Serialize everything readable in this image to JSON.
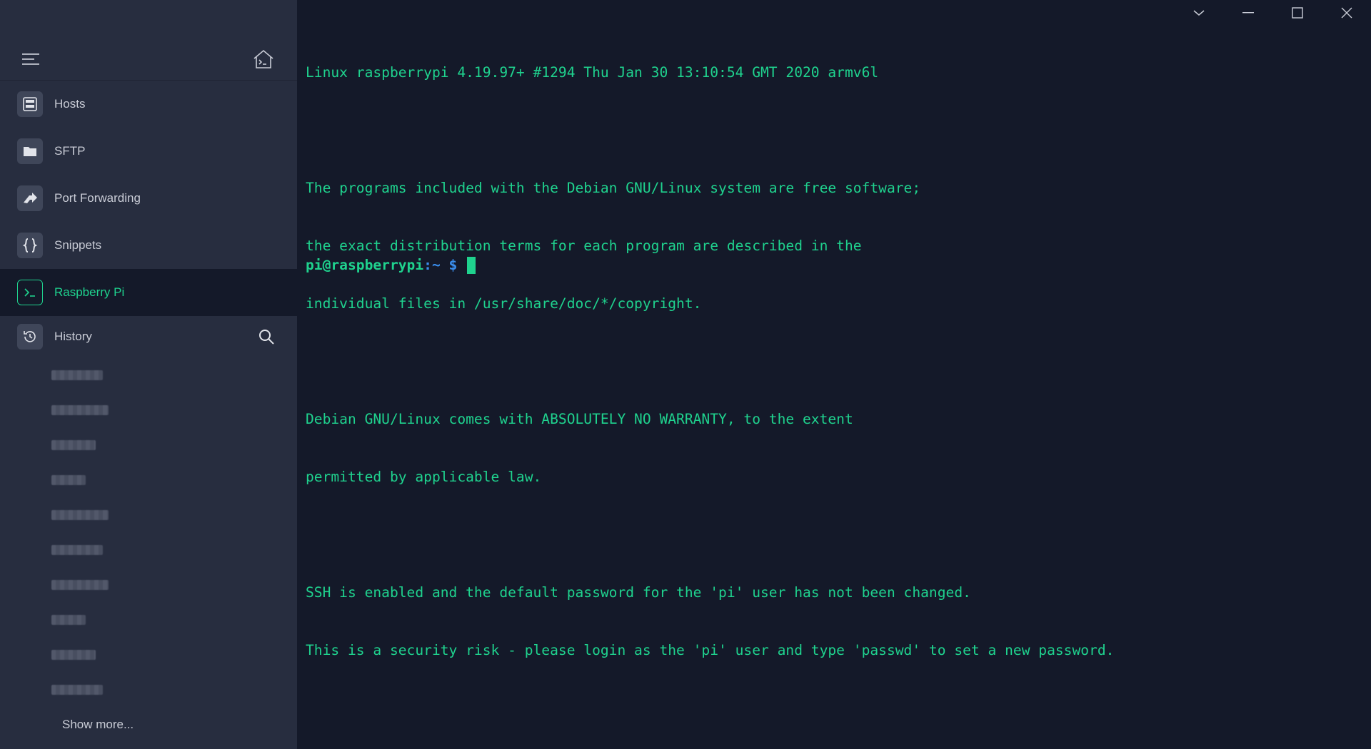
{
  "colors": {
    "accent": "#1fd28e",
    "sidebar_bg": "#272d3f",
    "terminal_bg": "#141929",
    "prompt_path": "#3a8ff0"
  },
  "sidebar": {
    "menu_icon": "hamburger-icon",
    "home_icon": "home-terminal-icon",
    "items": [
      {
        "label": "Hosts",
        "icon": "server-icon"
      },
      {
        "label": "SFTP",
        "icon": "folder-icon"
      },
      {
        "label": "Port Forwarding",
        "icon": "forward-arrow-icon"
      },
      {
        "label": "Snippets",
        "icon": "braces-icon"
      },
      {
        "label": "Raspberry Pi",
        "icon": "terminal-icon",
        "active": true
      }
    ],
    "history": {
      "label": "History",
      "icon": "history-icon",
      "search_icon": "search-icon",
      "items_count_visible": 10,
      "show_more_label": "Show more..."
    }
  },
  "terminal": {
    "lines": [
      "Linux raspberrypi 4.19.97+ #1294 Thu Jan 30 13:10:54 GMT 2020 armv6l",
      "",
      "The programs included with the Debian GNU/Linux system are free software;",
      "the exact distribution terms for each program are described in the",
      "individual files in /usr/share/doc/*/copyright.",
      "",
      "Debian GNU/Linux comes with ABSOLUTELY NO WARRANTY, to the extent",
      "permitted by applicable law.",
      "",
      "SSH is enabled and the default password for the 'pi' user has not been changed.",
      "This is a security risk - please login as the 'pi' user and type 'passwd' to set a new password."
    ],
    "prompt": {
      "user_host": "pi@raspberrypi",
      "path": ":~",
      "symbol": " $ "
    }
  },
  "window_controls": {
    "dropdown_icon": "chevron-down-icon",
    "minimize_icon": "minimize-icon",
    "maximize_icon": "maximize-icon",
    "close_icon": "close-icon"
  }
}
